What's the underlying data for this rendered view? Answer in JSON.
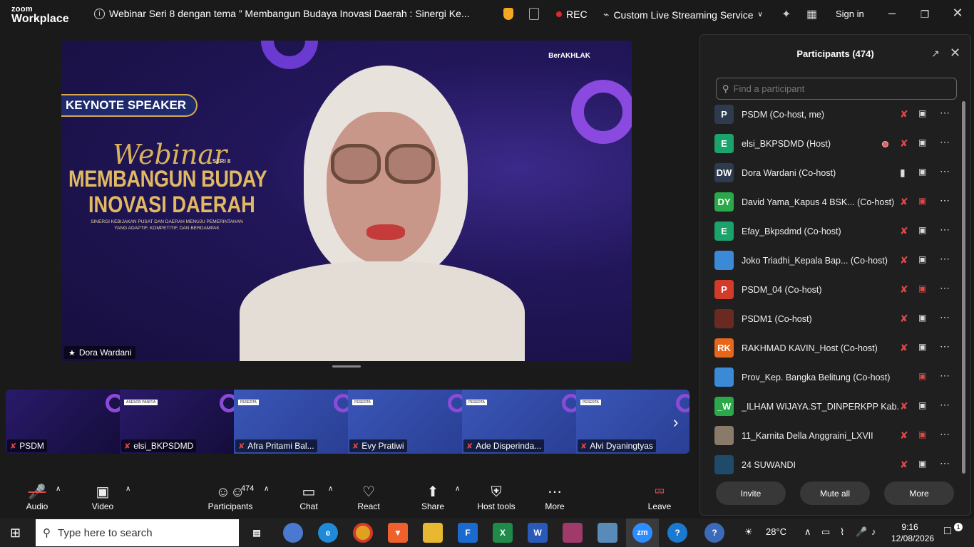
{
  "app": {
    "logo_line1": "zoom",
    "logo_line2": "Workplace",
    "meeting_title": "Webinar Seri 8 dengan tema ” Membangun Budaya Inovasi Daerah : Sinergi Ke...",
    "rec_label": "REC",
    "stream_label": "Custom Live Streaming Service",
    "signin_label": "Sign in"
  },
  "main_video": {
    "speaker_name": "Dora Wardani",
    "slide": {
      "keynote": "KEYNOTE SPEAKER",
      "script": "Webinar",
      "seri": "SERI 8",
      "line1": "MEMBANGUN BUDAY",
      "line2": "INOVASI DAERAH",
      "subtitle": "SINERGI KEBIJAKAN PUSAT DAN DAERAH MENUJU PEMERINTAHAN YANG ADAPTIF, KOMPETITIF, DAN BERDAMPAK",
      "brand": "BerAKHLAK"
    }
  },
  "thumbnails": [
    {
      "name": "PSDM",
      "style": "dark",
      "tag": ""
    },
    {
      "name": "elsi_BKPSDMD",
      "style": "dark",
      "tag": "ASESOR PANITIA"
    },
    {
      "name": "Afra Pritami Bal...",
      "style": "light",
      "tag": "PESERTA"
    },
    {
      "name": "Evy Pratiwi",
      "style": "light",
      "tag": "PESERTA"
    },
    {
      "name": "Ade Disperinda...",
      "style": "light",
      "tag": "PESERTA"
    },
    {
      "name": "Alvi Dyaningtyas",
      "style": "light",
      "tag": "PESERTA"
    }
  ],
  "toolbar": {
    "audio": "Audio",
    "video": "Video",
    "participants": "Participants",
    "participants_count": "474",
    "chat": "Chat",
    "react": "React",
    "share": "Share",
    "host_tools": "Host tools",
    "more": "More",
    "leave": "Leave"
  },
  "panel": {
    "title": "Participants (474)",
    "search_placeholder": "Find a participant",
    "participants": [
      {
        "initials": "P",
        "color": "#2e3a4e",
        "name": "PSDM (Co-host, me)",
        "mic": "muted",
        "cam": "on"
      },
      {
        "initials": "E",
        "color": "#1aa36b",
        "name": "elsi_BKPSDMD (Host)",
        "mic": "muted",
        "cam": "on",
        "recording": true
      },
      {
        "initials": "DW",
        "color": "#2e3a4e",
        "name": "Dora Wardani (Co-host)",
        "mic": "on",
        "cam": "on"
      },
      {
        "initials": "DY",
        "color": "#2aa84a",
        "name": "David Yama_Kapus 4 BSK... (Co-host)",
        "mic": "muted",
        "cam": "off"
      },
      {
        "initials": "E",
        "color": "#1aa36b",
        "name": "Efay_Bkpsdmd (Co-host)",
        "mic": "muted",
        "cam": "on"
      },
      {
        "initials": "",
        "color": "#3a8ad8",
        "name": "Joko Triadhi_Kepala Bap...  (Co-host)",
        "mic": "muted",
        "cam": "on"
      },
      {
        "initials": "P",
        "color": "#d23a2a",
        "name": "PSDM_04 (Co-host)",
        "mic": "muted",
        "cam": "off"
      },
      {
        "initials": "",
        "color": "#6a2a22",
        "name": "PSDM1 (Co-host)",
        "mic": "muted",
        "cam": "on"
      },
      {
        "initials": "RK",
        "color": "#e8661a",
        "name": "RAKHMAD KAVIN_Host (Co-host)",
        "mic": "muted",
        "cam": "on"
      },
      {
        "initials": "",
        "color": "#3a8ad8",
        "name": "Prov_Kep. Bangka Belitung (Co-host)",
        "mic": "",
        "cam": "off"
      },
      {
        "initials": "_W",
        "color": "#2aa84a",
        "name": "_ILHAM WIJAYA.ST_DINPERKPP Kab...",
        "mic": "muted",
        "cam": "on"
      },
      {
        "initials": "",
        "color": "#8a7a6a",
        "name": "11_Karnita Della Anggraini_LXVII",
        "mic": "muted",
        "cam": "off"
      },
      {
        "initials": "",
        "color": "#1f4a6a",
        "name": "24 SUWANDI",
        "mic": "muted",
        "cam": "on"
      }
    ],
    "invite": "Invite",
    "mute_all": "Mute all",
    "more": "More"
  },
  "taskbar": {
    "search_placeholder": "Type here to search",
    "weather": "28°C",
    "time": "9:16",
    "date": "12/08/2026",
    "notification_count": "1"
  }
}
